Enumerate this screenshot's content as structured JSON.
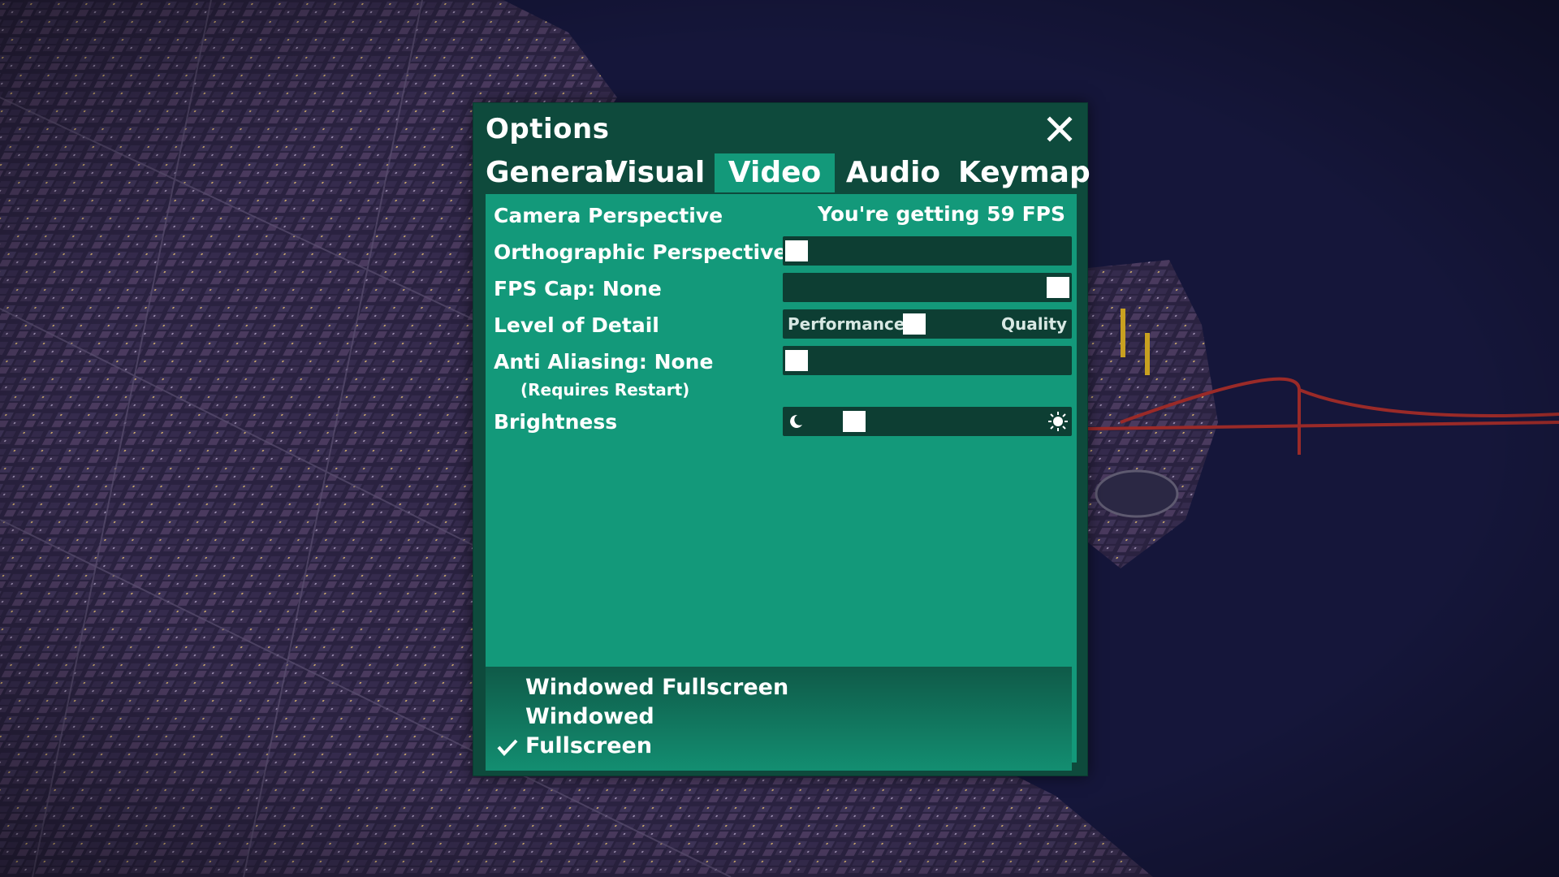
{
  "window": {
    "title": "Options",
    "close_label": "close"
  },
  "tabs": [
    {
      "label": "General",
      "active": false
    },
    {
      "label": "Visual",
      "active": false
    },
    {
      "label": "Video",
      "active": true
    },
    {
      "label": "Audio",
      "active": false
    },
    {
      "label": "Keymap",
      "active": false
    }
  ],
  "video": {
    "camera_perspective_label": "Camera Perspective",
    "fps_status": "You're getting 59 FPS",
    "orthographic_label": "Orthographic Perspective",
    "orthographic_enabled": false,
    "fps_cap_label": "FPS Cap: None",
    "fps_cap_level": 1.0,
    "level_of_detail_label": "Level of Detail",
    "lod_min_label": "Performance",
    "lod_max_label": "Quality",
    "lod_level": 0.45,
    "anti_aliasing_label": "Anti Aliasing: None",
    "anti_aliasing_note": "(Requires Restart)",
    "anti_aliasing_level": 0.0,
    "brightness_label": "Brightness",
    "brightness_min_icon": "moon-icon",
    "brightness_max_icon": "sun-icon",
    "brightness_level": 0.22
  },
  "display_modes": [
    {
      "label": "Windowed Fullscreen",
      "selected": false
    },
    {
      "label": "Windowed",
      "selected": false
    },
    {
      "label": "Fullscreen",
      "selected": true
    }
  ],
  "colors": {
    "window_bg": "#0e4a3c",
    "panel_bg": "#13997a",
    "track_bg": "#0d3e33",
    "text": "#ffffff"
  }
}
